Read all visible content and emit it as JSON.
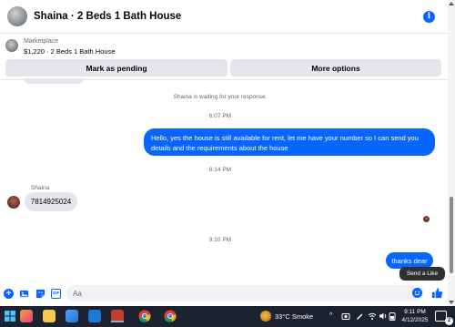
{
  "header": {
    "title": "Shaina · 2 Beds 1 Bath House"
  },
  "marketplace": {
    "label": "Marketplace",
    "item": "$1,220 · 2 Beds 1 Bath House",
    "pending_button": "Mark as pending",
    "options_button": "More options"
  },
  "messages": {
    "system_notice": "Shaina is waiting for your response.",
    "time_1": "6:07 PM",
    "outgoing_1": "Hello, yes the house is still available for rent, let me have your number so I can send you details and the requirements about the house",
    "time_2": "8:14 PM",
    "sender_name": "Shaina",
    "incoming_1": "7814925024",
    "time_3": "9:10 PM",
    "outgoing_2": "thanks dear",
    "tooltip": "Send a Like"
  },
  "composer": {
    "placeholder": "Aa",
    "value": ""
  },
  "taskbar": {
    "weather": "33°C  Smoke",
    "time": "9:11 PM",
    "date": "4/12/2025",
    "notification_count": "2"
  },
  "colors": {
    "accent": "#0866ff",
    "bubble_in": "#e4e6eb",
    "taskbar": "#1c2230"
  }
}
